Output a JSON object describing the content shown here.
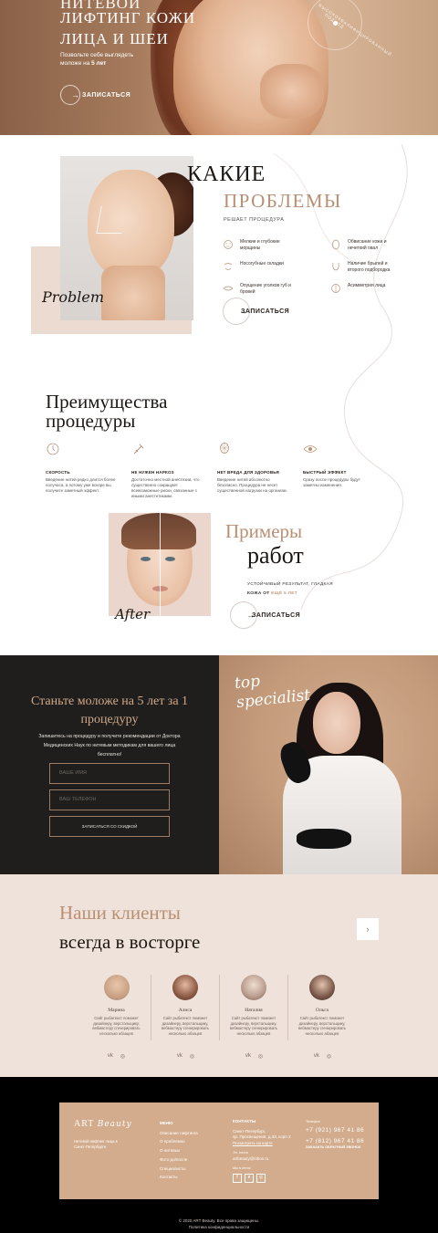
{
  "hero": {
    "title_cut": "НИТЕВОЙ",
    "title_line1": "ЛИФТИНГ КОЖИ",
    "title_line2": "ЛИЦА И ШЕИ",
    "subtitle_prefix": "Позвольте себе выглядеть моложе на",
    "subtitle_bold": "5 лет",
    "button_label": "ЗАПИСАТЬСЯ",
    "badge_text": "ВЫСОКОКВАЛИФИЦИРОВАННЫЙ ПОДХОД"
  },
  "problems": {
    "script_word": "Problem",
    "title_line1": "КАКИЕ",
    "title_line2": "ПРОБЛЕМЫ",
    "subtitle": "РЕШАЕТ ПРОЦЕДУРА",
    "items_left": [
      {
        "icon": "face-wrinkles-icon",
        "text": "Мелкие и глубокие морщины"
      },
      {
        "icon": "nasolabial-icon",
        "text": "Носогубные складки"
      },
      {
        "icon": "lips-icon",
        "text": "Опущение уголков губ и бровей"
      }
    ],
    "items_right": [
      {
        "icon": "face-oval-icon",
        "text": "Обвисание кожи и нечеткий овал"
      },
      {
        "icon": "chin-icon",
        "text": "Наличие брылей и второго подбородка"
      },
      {
        "icon": "asymmetry-icon",
        "text": "Асимметрия лица"
      }
    ],
    "button_label": "ЗАПИСАТЬСЯ"
  },
  "advantages": {
    "title_line1": "Преимущества",
    "title_line2": "процедуры",
    "items": [
      {
        "icon": "clock-icon",
        "heading": "СКОРОСТЬ",
        "text": "Введение нитей редко длится более получаса, а потому уже вскоре вы получите заметный эффект."
      },
      {
        "icon": "syringe-icon",
        "heading": "НЕ НУЖЕН НАРКОЗ",
        "text": "Достаточно местной анестезии, что существенно сокращает всевозможные риски, связанные с иными анестетиками."
      },
      {
        "icon": "face-mesh-icon",
        "heading": "НЕТ ВРЕДА ДЛЯ ЗДОРОВЬЯ",
        "text": "Введение нитей абсолютно безопасно. Процедура не несет существенной нагрузки на организм."
      },
      {
        "icon": "eye-icon",
        "heading": "БЫСТРЫЙ ЭФФЕКТ",
        "text": "Сразу после процедуры будут заметны изменения."
      }
    ]
  },
  "examples": {
    "script_word": "After",
    "title_line1": "Примеры",
    "title_line2": "работ",
    "subtitle_line1": "УСТОЙЧИВЫЙ РЕЗУЛЬТАТ, ГЛАДКАЯ",
    "subtitle_prefix": "КОЖА ОТ",
    "subtitle_accent": "ЕЩЁ 5 ЛЕТ",
    "button_label": "ЗАПИСАТЬСЯ"
  },
  "cta": {
    "title": "Станьте моложе на 5 лет за 1 процедуру",
    "text": "Запишитесь на процедуру и получите рекомендации от Доктора Медицинских Наук по нитевым методикам для вашего лица бесплатно!",
    "name_placeholder": "ВАШЕ ИМЯ",
    "phone_placeholder": "ВАШ ТЕЛЕФОН",
    "submit_label": "ЗАПИСАТЬСЯ СО СКИДКОЙ",
    "script_line1": "top",
    "script_line2": "specialist"
  },
  "clients": {
    "title_line1": "Наши клиенты",
    "title_line2": "всегда в восторге",
    "next_icon": "chevron-right-icon",
    "cards": [
      {
        "name": "Марина",
        "desc": "Сайт рыбатекст поможет дизайнеру, верстальщику, вебмастеру сгенерировать несколько абзацев",
        "color": "#c9a284"
      },
      {
        "name": "Алиса",
        "desc": "Сайт рыбатекст поможет дизайнеру, верстальщику, вебмастеру сгенерировать несколько абзацев",
        "color": "#8c5a45"
      },
      {
        "name": "Наталия",
        "desc": "Сайт рыбатекст поможет дизайнеру, верстальщику, вебмастеру сгенерировать несколько абзацев",
        "color": "#b99d8e"
      },
      {
        "name": "Ольга",
        "desc": "Сайт рыбатекст поможет дизайнеру, верстальщику, вебмастеру сгенерировать несколько абзацев",
        "color": "#7a5849"
      }
    ],
    "social_vk": "vk",
    "social_ig": "◎"
  },
  "footer": {
    "logo_main": "ART",
    "logo_script": "Beauty",
    "tagline": "Нитевой лифтинг лица в Санкт-Петербурге",
    "menu_heading": "МЕНЮ",
    "menu_items": [
      "Описание лифтинга",
      "О проблемах",
      "О нитевых",
      "Фото до/после",
      "Специалисты",
      "Контакты"
    ],
    "contacts_heading": "КОНТАКТЫ",
    "address_line1": "Санкт-Петербург,",
    "address_line2": "пр. Просвещения, д.33, корп 2",
    "map_link": "Посмотреть на карте",
    "email_label": "Эл. почта",
    "email": "artbeauty@inbox.ru",
    "social_label": "Мы в сетях",
    "phones_label": "Телефон",
    "phone1": "+7 (921) 967 41 86",
    "phone2": "+7 (812) 967 41 86",
    "call_link": "ЗАКАЗАТЬ ОБРАТНЫЙ ЗВОНОК",
    "copyright": "© 2020 ART Beauty. Все права защищены.",
    "policy": "Политика конфиденциальности"
  }
}
